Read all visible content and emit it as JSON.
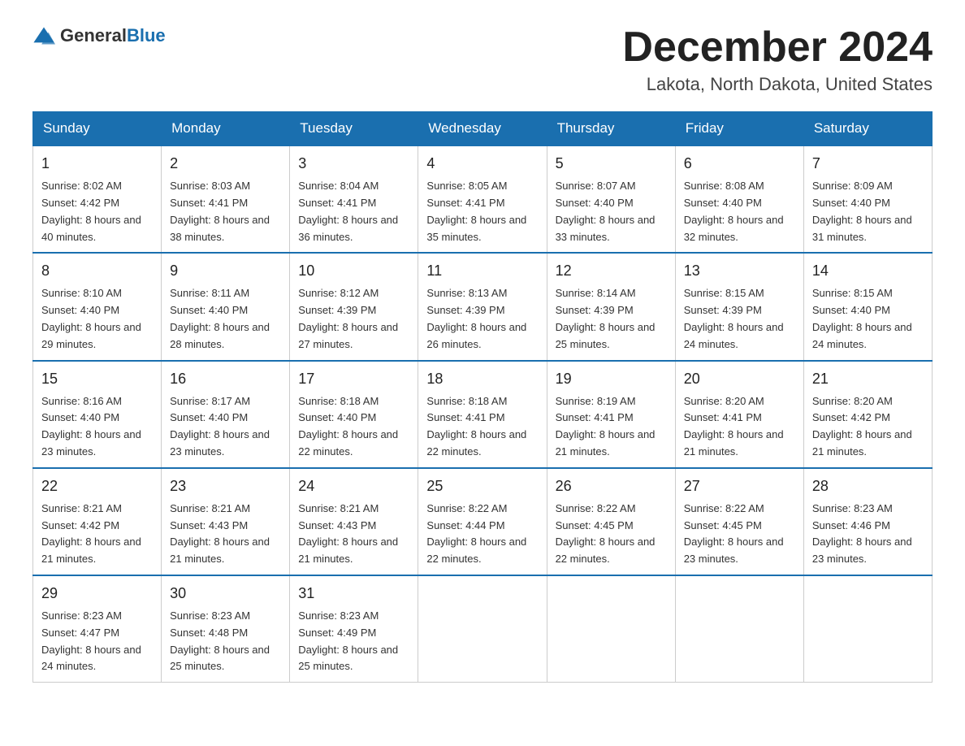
{
  "logo": {
    "text_general": "General",
    "text_blue": "Blue"
  },
  "header": {
    "title": "December 2024",
    "subtitle": "Lakota, North Dakota, United States"
  },
  "weekdays": [
    "Sunday",
    "Monday",
    "Tuesday",
    "Wednesday",
    "Thursday",
    "Friday",
    "Saturday"
  ],
  "weeks": [
    [
      {
        "day": "1",
        "sunrise": "8:02 AM",
        "sunset": "4:42 PM",
        "daylight": "8 hours and 40 minutes."
      },
      {
        "day": "2",
        "sunrise": "8:03 AM",
        "sunset": "4:41 PM",
        "daylight": "8 hours and 38 minutes."
      },
      {
        "day": "3",
        "sunrise": "8:04 AM",
        "sunset": "4:41 PM",
        "daylight": "8 hours and 36 minutes."
      },
      {
        "day": "4",
        "sunrise": "8:05 AM",
        "sunset": "4:41 PM",
        "daylight": "8 hours and 35 minutes."
      },
      {
        "day": "5",
        "sunrise": "8:07 AM",
        "sunset": "4:40 PM",
        "daylight": "8 hours and 33 minutes."
      },
      {
        "day": "6",
        "sunrise": "8:08 AM",
        "sunset": "4:40 PM",
        "daylight": "8 hours and 32 minutes."
      },
      {
        "day": "7",
        "sunrise": "8:09 AM",
        "sunset": "4:40 PM",
        "daylight": "8 hours and 31 minutes."
      }
    ],
    [
      {
        "day": "8",
        "sunrise": "8:10 AM",
        "sunset": "4:40 PM",
        "daylight": "8 hours and 29 minutes."
      },
      {
        "day": "9",
        "sunrise": "8:11 AM",
        "sunset": "4:40 PM",
        "daylight": "8 hours and 28 minutes."
      },
      {
        "day": "10",
        "sunrise": "8:12 AM",
        "sunset": "4:39 PM",
        "daylight": "8 hours and 27 minutes."
      },
      {
        "day": "11",
        "sunrise": "8:13 AM",
        "sunset": "4:39 PM",
        "daylight": "8 hours and 26 minutes."
      },
      {
        "day": "12",
        "sunrise": "8:14 AM",
        "sunset": "4:39 PM",
        "daylight": "8 hours and 25 minutes."
      },
      {
        "day": "13",
        "sunrise": "8:15 AM",
        "sunset": "4:39 PM",
        "daylight": "8 hours and 24 minutes."
      },
      {
        "day": "14",
        "sunrise": "8:15 AM",
        "sunset": "4:40 PM",
        "daylight": "8 hours and 24 minutes."
      }
    ],
    [
      {
        "day": "15",
        "sunrise": "8:16 AM",
        "sunset": "4:40 PM",
        "daylight": "8 hours and 23 minutes."
      },
      {
        "day": "16",
        "sunrise": "8:17 AM",
        "sunset": "4:40 PM",
        "daylight": "8 hours and 23 minutes."
      },
      {
        "day": "17",
        "sunrise": "8:18 AM",
        "sunset": "4:40 PM",
        "daylight": "8 hours and 22 minutes."
      },
      {
        "day": "18",
        "sunrise": "8:18 AM",
        "sunset": "4:41 PM",
        "daylight": "8 hours and 22 minutes."
      },
      {
        "day": "19",
        "sunrise": "8:19 AM",
        "sunset": "4:41 PM",
        "daylight": "8 hours and 21 minutes."
      },
      {
        "day": "20",
        "sunrise": "8:20 AM",
        "sunset": "4:41 PM",
        "daylight": "8 hours and 21 minutes."
      },
      {
        "day": "21",
        "sunrise": "8:20 AM",
        "sunset": "4:42 PM",
        "daylight": "8 hours and 21 minutes."
      }
    ],
    [
      {
        "day": "22",
        "sunrise": "8:21 AM",
        "sunset": "4:42 PM",
        "daylight": "8 hours and 21 minutes."
      },
      {
        "day": "23",
        "sunrise": "8:21 AM",
        "sunset": "4:43 PM",
        "daylight": "8 hours and 21 minutes."
      },
      {
        "day": "24",
        "sunrise": "8:21 AM",
        "sunset": "4:43 PM",
        "daylight": "8 hours and 21 minutes."
      },
      {
        "day": "25",
        "sunrise": "8:22 AM",
        "sunset": "4:44 PM",
        "daylight": "8 hours and 22 minutes."
      },
      {
        "day": "26",
        "sunrise": "8:22 AM",
        "sunset": "4:45 PM",
        "daylight": "8 hours and 22 minutes."
      },
      {
        "day": "27",
        "sunrise": "8:22 AM",
        "sunset": "4:45 PM",
        "daylight": "8 hours and 23 minutes."
      },
      {
        "day": "28",
        "sunrise": "8:23 AM",
        "sunset": "4:46 PM",
        "daylight": "8 hours and 23 minutes."
      }
    ],
    [
      {
        "day": "29",
        "sunrise": "8:23 AM",
        "sunset": "4:47 PM",
        "daylight": "8 hours and 24 minutes."
      },
      {
        "day": "30",
        "sunrise": "8:23 AM",
        "sunset": "4:48 PM",
        "daylight": "8 hours and 25 minutes."
      },
      {
        "day": "31",
        "sunrise": "8:23 AM",
        "sunset": "4:49 PM",
        "daylight": "8 hours and 25 minutes."
      },
      null,
      null,
      null,
      null
    ]
  ]
}
